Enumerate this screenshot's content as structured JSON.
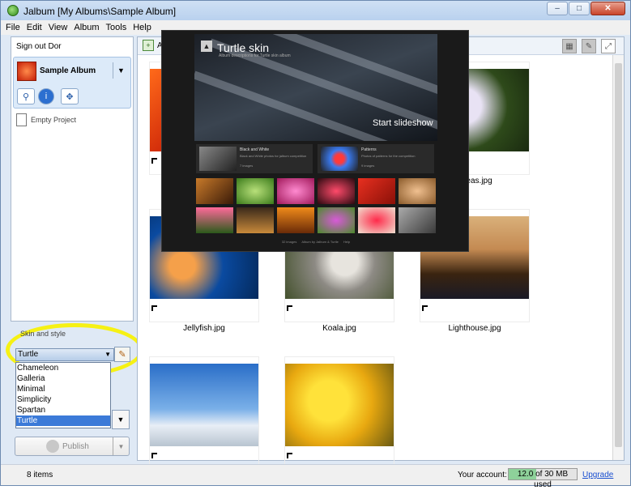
{
  "window": {
    "title": "Jalbum [My Albums\\Sample Album]",
    "controls": [
      "–",
      "□",
      "✕"
    ]
  },
  "menu": [
    "File",
    "Edit",
    "View",
    "Album",
    "Tools",
    "Help"
  ],
  "sidebar": {
    "sign_out": "Sign out Dor",
    "album_name": "Sample Album",
    "project_label": "Empty Project",
    "skin_legend": "Skin and style",
    "skin_selected": "Turtle",
    "skin_options": [
      "Chameleon",
      "Galleria",
      "Minimal",
      "Simplicity",
      "Spartan",
      "Turtle"
    ],
    "publish_label": "Publish"
  },
  "main": {
    "add_label": "A",
    "captions": [
      "Jellyfish.jpg",
      "Koala.jpg",
      "Lighthouse.jpg",
      "ngeas.jpg"
    ]
  },
  "preview": {
    "title": "Turtle skin",
    "subtitle": "Album descriptions for Turtle skin album",
    "start_label": "Start slideshow",
    "folders": [
      {
        "name": "Black and White",
        "desc": "Black and White photos for jalbum competition",
        "count": "7 images"
      },
      {
        "name": "Patterns",
        "desc": "Photos of patterns for the competition",
        "count": "9 images"
      }
    ],
    "footer": [
      "32 images",
      "Album by Jalbum & Turtle",
      "Help"
    ]
  },
  "status": {
    "items": "8 items",
    "account_label": "Your account:",
    "usage": "12.0 of 30 MB used",
    "usage_fraction": 0.4,
    "upgrade": "Upgrade"
  }
}
